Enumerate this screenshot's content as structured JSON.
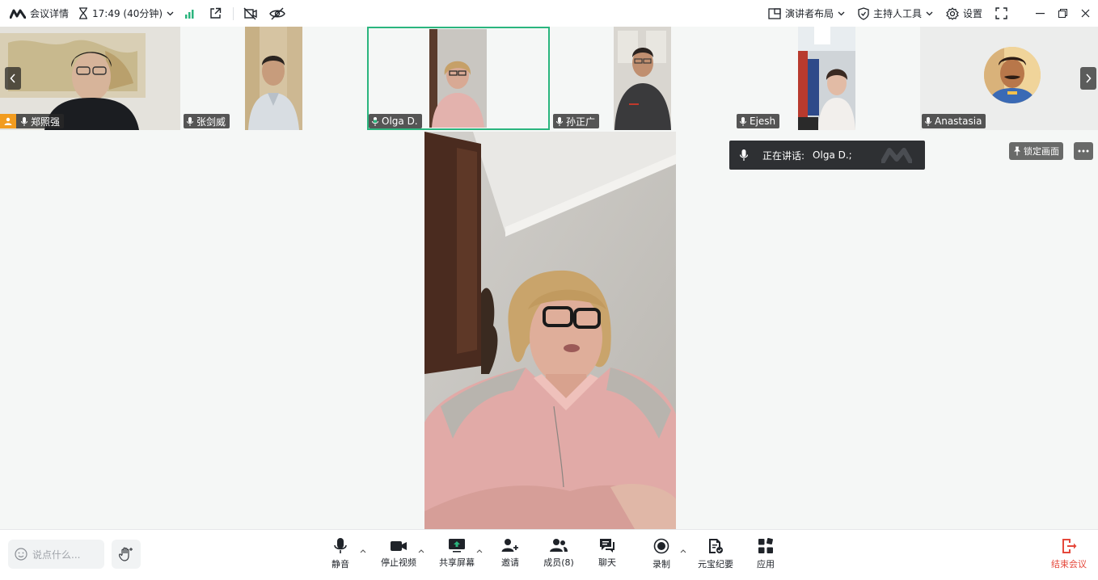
{
  "topbar": {
    "meeting_details": "会议详情",
    "timer": "17:49 (40分钟)",
    "layout": "演讲者布局",
    "host_tools": "主持人工具",
    "settings": "设置"
  },
  "participants": [
    {
      "name": "郑照强",
      "host": true
    },
    {
      "name": "张剑威"
    },
    {
      "name": "Olga D.",
      "active": true
    },
    {
      "name": "孙正广"
    },
    {
      "name": "Ejesh"
    },
    {
      "name": "Anastasia"
    }
  ],
  "speaking": {
    "label": "正在讲话:",
    "name": "Olga D.;"
  },
  "lock_label": "锁定画面",
  "chat_placeholder": "说点什么...",
  "toolbar": {
    "mute": "静音",
    "stop_video": "停止视频",
    "share_screen": "共享屏幕",
    "invite": "邀请",
    "members": "成员(8)",
    "chat": "聊天",
    "record": "录制",
    "summary": "元宝纪要",
    "apps": "应用",
    "end": "结束会议"
  },
  "colors": {
    "accent": "#2bb57e",
    "end": "#e5483b",
    "host_badge": "#f29c1f"
  }
}
